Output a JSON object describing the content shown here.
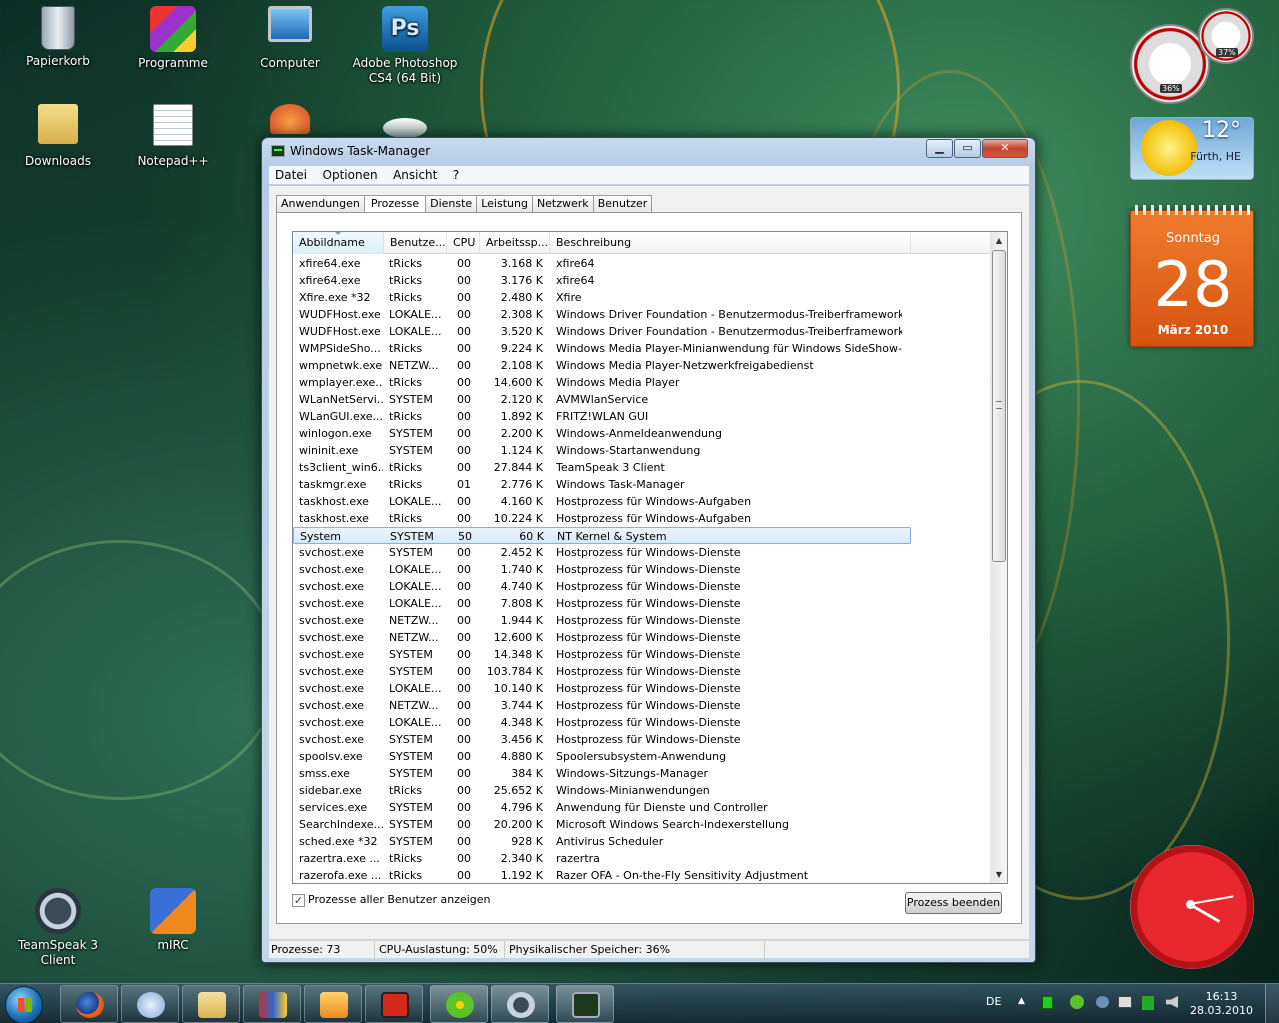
{
  "desktop": {
    "icons": [
      {
        "label": "Papierkorb"
      },
      {
        "label": "Programme"
      },
      {
        "label": "Computer"
      },
      {
        "label": "Adobe Photoshop CS4 (64 Bit)"
      },
      {
        "label": "Downloads"
      },
      {
        "label": "Notepad++"
      },
      {
        "label": "TeamSpeak 3 Client"
      },
      {
        "label": "mIRC"
      }
    ]
  },
  "gadgets": {
    "meter": {
      "cpu": "36%",
      "ram": "37%"
    },
    "weather": {
      "temp": "12°",
      "location": "Fürth, HE"
    },
    "calendar": {
      "weekday": "Sonntag",
      "day": "28",
      "month": "März 2010"
    }
  },
  "window": {
    "title": "Windows Task-Manager",
    "buttons": {
      "minimize": "▁",
      "maximize": "▭",
      "close": "✕"
    },
    "menu": [
      "Datei",
      "Optionen",
      "Ansicht",
      "?"
    ],
    "tabs": [
      "Anwendungen",
      "Prozesse",
      "Dienste",
      "Leistung",
      "Netzwerk",
      "Benutzer"
    ],
    "columns": [
      "Abbildname",
      "Benutze...",
      "CPU",
      "Arbeitssp...",
      "Beschreibung"
    ],
    "rows": [
      [
        "xfire64.exe",
        "tRicks",
        "00",
        "3.168 K",
        "xfire64"
      ],
      [
        "xfire64.exe",
        "tRicks",
        "00",
        "3.176 K",
        "xfire64"
      ],
      [
        "Xfire.exe *32",
        "tRicks",
        "00",
        "2.480 K",
        "Xfire"
      ],
      [
        "WUDFHost.exe",
        "LOKALE...",
        "00",
        "2.308 K",
        "Windows Driver Foundation - Benutzermodus-Treiberframework-Host..."
      ],
      [
        "WUDFHost.exe",
        "LOKALE...",
        "00",
        "3.520 K",
        "Windows Driver Foundation - Benutzermodus-Treiberframework-Host..."
      ],
      [
        "WMPSideSho...",
        "tRicks",
        "00",
        "9.224 K",
        "Windows Media Player-Minianwendung für Windows SideShow-kompa..."
      ],
      [
        "wmpnetwk.exe",
        "NETZW...",
        "00",
        "2.108 K",
        "Windows Media Player-Netzwerkfreigabedienst"
      ],
      [
        "wmplayer.exe...",
        "tRicks",
        "00",
        "14.600 K",
        "Windows Media Player"
      ],
      [
        "WLanNetServi...",
        "SYSTEM",
        "00",
        "2.120 K",
        "AVMWlanService"
      ],
      [
        "WLanGUI.exe...",
        "tRicks",
        "00",
        "1.892 K",
        "FRITZ!WLAN GUI"
      ],
      [
        "winlogon.exe",
        "SYSTEM",
        "00",
        "2.200 K",
        "Windows-Anmeldeanwendung"
      ],
      [
        "wininit.exe",
        "SYSTEM",
        "00",
        "1.124 K",
        "Windows-Startanwendung"
      ],
      [
        "ts3client_win6...",
        "tRicks",
        "00",
        "27.844 K",
        "TeamSpeak 3 Client"
      ],
      [
        "taskmgr.exe",
        "tRicks",
        "01",
        "2.776 K",
        "Windows Task-Manager"
      ],
      [
        "taskhost.exe",
        "LOKALE...",
        "00",
        "4.160 K",
        "Hostprozess für Windows-Aufgaben"
      ],
      [
        "taskhost.exe",
        "tRicks",
        "00",
        "10.224 K",
        "Hostprozess für Windows-Aufgaben"
      ],
      [
        "System",
        "SYSTEM",
        "50",
        "60 K",
        "NT Kernel & System"
      ],
      [
        "svchost.exe",
        "SYSTEM",
        "00",
        "2.452 K",
        "Hostprozess für Windows-Dienste"
      ],
      [
        "svchost.exe",
        "LOKALE...",
        "00",
        "1.740 K",
        "Hostprozess für Windows-Dienste"
      ],
      [
        "svchost.exe",
        "LOKALE...",
        "00",
        "4.740 K",
        "Hostprozess für Windows-Dienste"
      ],
      [
        "svchost.exe",
        "LOKALE...",
        "00",
        "7.808 K",
        "Hostprozess für Windows-Dienste"
      ],
      [
        "svchost.exe",
        "NETZW...",
        "00",
        "1.944 K",
        "Hostprozess für Windows-Dienste"
      ],
      [
        "svchost.exe",
        "NETZW...",
        "00",
        "12.600 K",
        "Hostprozess für Windows-Dienste"
      ],
      [
        "svchost.exe",
        "SYSTEM",
        "00",
        "14.348 K",
        "Hostprozess für Windows-Dienste"
      ],
      [
        "svchost.exe",
        "SYSTEM",
        "00",
        "103.784 K",
        "Hostprozess für Windows-Dienste"
      ],
      [
        "svchost.exe",
        "LOKALE...",
        "00",
        "10.140 K",
        "Hostprozess für Windows-Dienste"
      ],
      [
        "svchost.exe",
        "NETZW...",
        "00",
        "3.744 K",
        "Hostprozess für Windows-Dienste"
      ],
      [
        "svchost.exe",
        "LOKALE...",
        "00",
        "4.348 K",
        "Hostprozess für Windows-Dienste"
      ],
      [
        "svchost.exe",
        "SYSTEM",
        "00",
        "3.456 K",
        "Hostprozess für Windows-Dienste"
      ],
      [
        "spoolsv.exe",
        "SYSTEM",
        "00",
        "4.880 K",
        "Spoolersubsystem-Anwendung"
      ],
      [
        "smss.exe",
        "SYSTEM",
        "00",
        "384 K",
        "Windows-Sitzungs-Manager"
      ],
      [
        "sidebar.exe",
        "tRicks",
        "00",
        "25.652 K",
        "Windows-Minianwendungen"
      ],
      [
        "services.exe",
        "SYSTEM",
        "00",
        "4.796 K",
        "Anwendung für Dienste und Controller"
      ],
      [
        "SearchIndexe...",
        "SYSTEM",
        "00",
        "20.200 K",
        "Microsoft Windows Search-Indexerstellung"
      ],
      [
        "sched.exe *32",
        "SYSTEM",
        "00",
        "928 K",
        "Antivirus Scheduler"
      ],
      [
        "razertra.exe ...",
        "tRicks",
        "00",
        "2.340 K",
        "razertra"
      ],
      [
        "razerofa.exe ...",
        "tRicks",
        "00",
        "1.192 K",
        "Razer OFA - On-the-Fly Sensitivity Adjustment"
      ]
    ],
    "selected_row_index": 16,
    "show_all_label": "Prozesse aller Benutzer anzeigen",
    "end_process_label": "Prozess beenden",
    "status": {
      "processes": "Prozesse: 73",
      "cpu": "CPU-Auslastung: 50%",
      "memory": "Physikalischer Speicher: 36%"
    }
  },
  "taskbar": {
    "language": "DE",
    "time": "16:13",
    "date": "28.03.2010"
  }
}
